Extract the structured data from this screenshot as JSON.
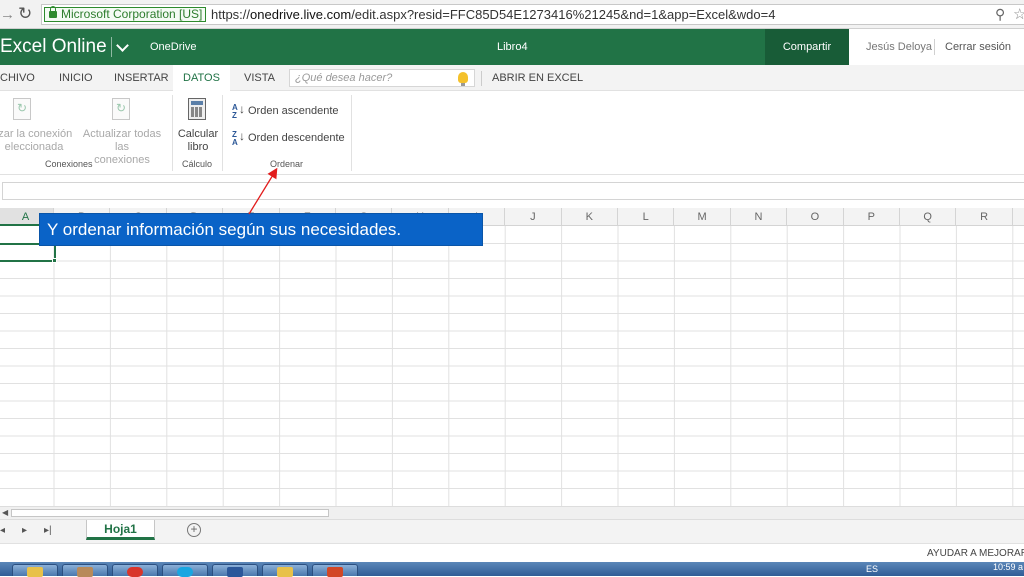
{
  "browser": {
    "ev_label": "Microsoft Corporation [US]",
    "url_prefix": "https://",
    "url_host": "onedrive.live.com",
    "url_path": "/edit.aspx?resid=FFC85D54E1273416%21245&nd=1&app=Excel&wdo=4"
  },
  "header": {
    "app_name": "Excel Online",
    "onedrive": "OneDrive",
    "doc_title": "Libro4",
    "share": "Compartir",
    "user": "Jesús Deloya",
    "sign_out": "Cerrar sesión",
    "brand_color": "#217346"
  },
  "tabs": {
    "archivo": "CHIVO",
    "inicio": "INICIO",
    "insertar": "INSERTAR",
    "datos": "DATOS",
    "vista": "VISTA",
    "tell_me_placeholder": "¿Qué desea hacer?",
    "open_excel": "ABRIR EN EXCEL"
  },
  "ribbon": {
    "refresh_selected": "izar la conexión\neleccionada",
    "refresh_all": "Actualizar todas las\nconexiones",
    "group_connections": "Conexiones",
    "calc_book": "Calcular\nlibro",
    "group_calc": "Cálculo",
    "sort_asc": "Orden ascendente",
    "sort_desc": "Orden descendente",
    "group_sort": "Ordenar"
  },
  "grid": {
    "columns": [
      "A",
      "B",
      "C",
      "D",
      "E",
      "F",
      "G",
      "H",
      "I",
      "J",
      "K",
      "L",
      "M",
      "N",
      "O",
      "P",
      "Q",
      "R"
    ],
    "selected_column": "A"
  },
  "callout": {
    "text": "Y ordenar información según sus necesidades."
  },
  "sheets": {
    "active": "Hoja1"
  },
  "status": {
    "help_improve": "AYUDAR A MEJORAR O"
  },
  "taskbar": {
    "lang": "ES",
    "clock": "10:59 a"
  }
}
